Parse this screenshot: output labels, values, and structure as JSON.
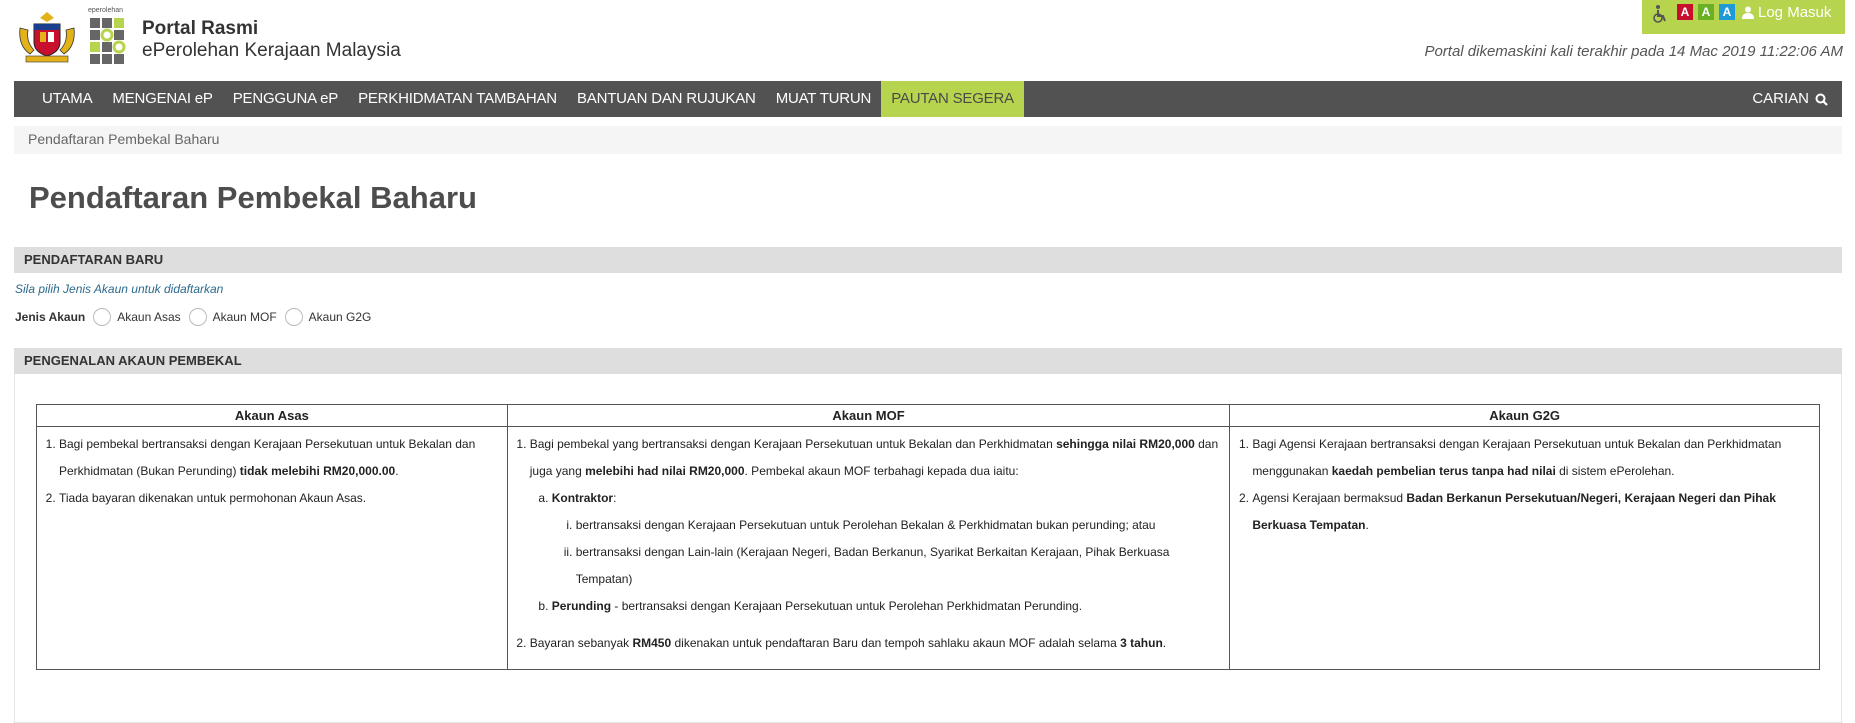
{
  "header": {
    "ep_small": "eperolehan",
    "brand_title": "Portal Rasmi",
    "brand_sub": "ePerolehan Kerajaan Malaysia",
    "font_sizes": [
      "A",
      "A",
      "A"
    ],
    "login_label": "Log Masuk",
    "updated_text": "Portal dikemaskini kali terakhir pada 14 Mac 2019 11:22:06 AM"
  },
  "nav": {
    "items": [
      "UTAMA",
      "MENGENAI eP",
      "PENGGUNA eP",
      "PERKHIDMATAN TAMBAHAN",
      "BANTUAN DAN RUJUKAN",
      "MUAT TURUN",
      "PAUTAN SEGERA"
    ],
    "search_label": "CARIAN"
  },
  "breadcrumb": "Pendaftaran Pembekal Baharu",
  "page_title": "Pendaftaran Pembekal Baharu",
  "registration": {
    "section_title": "PENDAFTARAN BARU",
    "hint": "Sila pilih Jenis Akaun untuk didaftarkan",
    "account_type_label": "Jenis Akaun",
    "options": [
      "Akaun Asas",
      "Akaun MOF",
      "Akaun G2G"
    ]
  },
  "intro": {
    "section_title": "PENGENALAN AKAUN PEMBEKAL",
    "columns": [
      "Akaun Asas",
      "Akaun MOF",
      "Akaun G2G"
    ],
    "asas": {
      "p1a": "Bagi pembekal bertransaksi dengan Kerajaan Persekutuan untuk Bekalan dan Perkhidmatan (Bukan Perunding) ",
      "p1b": "tidak melebihi RM20,000.00",
      "p1c": ".",
      "p2": "Tiada bayaran dikenakan untuk permohonan Akaun Asas."
    },
    "mof": {
      "p1a": "Bagi pembekal yang bertransaksi dengan Kerajaan Persekutuan untuk Bekalan dan Perkhidmatan ",
      "p1b": "sehingga nilai RM20,000",
      "p1c": " dan juga yang ",
      "p1d": "melebihi had nilai RM20,000",
      "p1e": ". Pembekal akaun MOF terbahagi kepada dua iaitu:",
      "a_title": "Kontraktor",
      "a_colon": ":",
      "a_i": "bertransaksi dengan Kerajaan Persekutuan untuk Perolehan Bekalan & Perkhidmatan bukan perunding; atau",
      "a_ii": "bertransaksi dengan Lain-lain (Kerajaan Negeri, Badan Berkanun, Syarikat Berkaitan Kerajaan, Pihak Berkuasa Tempatan)",
      "b_title": "Perunding",
      "b_text": " - bertransaksi dengan Kerajaan Persekutuan untuk Perolehan Perkhidmatan Perunding.",
      "p2a": "Bayaran sebanyak ",
      "p2b": "RM450",
      "p2c": " dikenakan untuk pendaftaran Baru dan tempoh sahlaku akaun MOF adalah selama ",
      "p2d": "3 tahun",
      "p2e": "."
    },
    "g2g": {
      "p1a": "Bagi Agensi Kerajaan bertransaksi dengan Kerajaan Persekutuan untuk Bekalan dan Perkhidmatan menggunakan ",
      "p1b": "kaedah pembelian terus tanpa had nilai",
      "p1c": " di sistem ePerolehan.",
      "p2a": "Agensi Kerajaan bermaksud ",
      "p2b": "Badan Berkanun Persekutuan/Negeri, Kerajaan Negeri dan Pihak Berkuasa Tempatan",
      "p2c": "."
    }
  },
  "colors": {
    "nav_bg": "#525252",
    "accent": "#b7d44f",
    "section_bg": "#dedede",
    "hint": "#2b6a8e"
  }
}
